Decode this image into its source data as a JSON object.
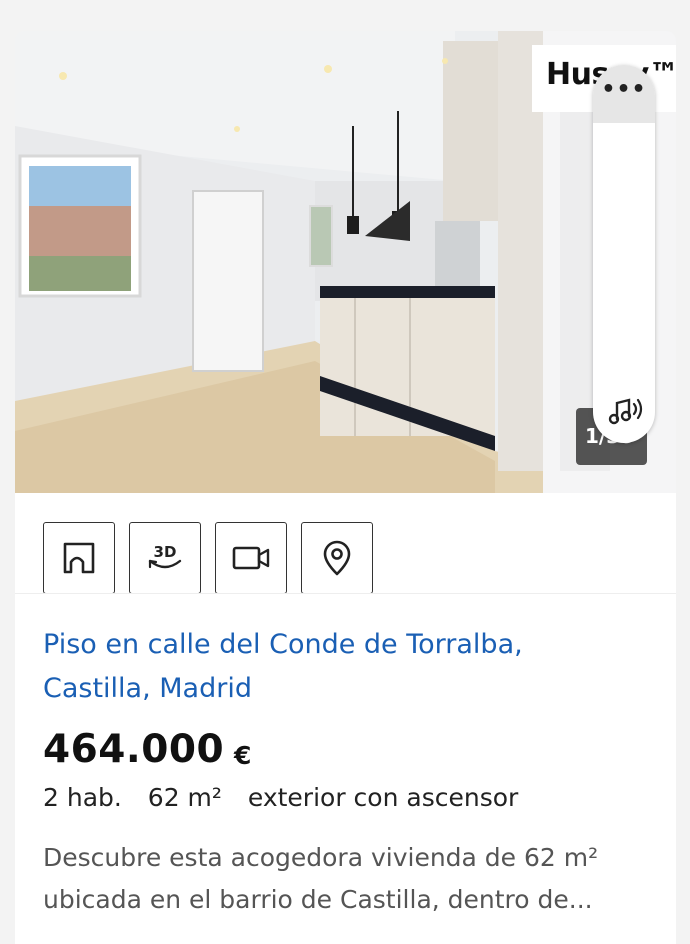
{
  "listing": {
    "photo_counter": "1/35",
    "brand_logo": "Huspy™",
    "more_menu_label": "•••",
    "title_line1": "Piso en calle del Conde de Torralba,",
    "title_line2": "Castilla, Madrid",
    "price": "464.000",
    "currency": "€",
    "details": {
      "rooms": "2 hab.",
      "area": "62 m²",
      "features": "exterior con ascensor"
    },
    "description_line1": "Descubre esta acogedora vivienda de 62 m²",
    "description_line2": "ubicada en el barrio de Castilla, dentro de..."
  },
  "icons": {
    "floor_plan": "floor-plan-icon",
    "tour_3d": "3d-tour-icon",
    "video": "video-icon",
    "map": "map-pin-icon",
    "sound": "sound-icon"
  },
  "colors": {
    "title": "#1a5fb4",
    "price": "#111111",
    "background": "#f3f3f3"
  }
}
